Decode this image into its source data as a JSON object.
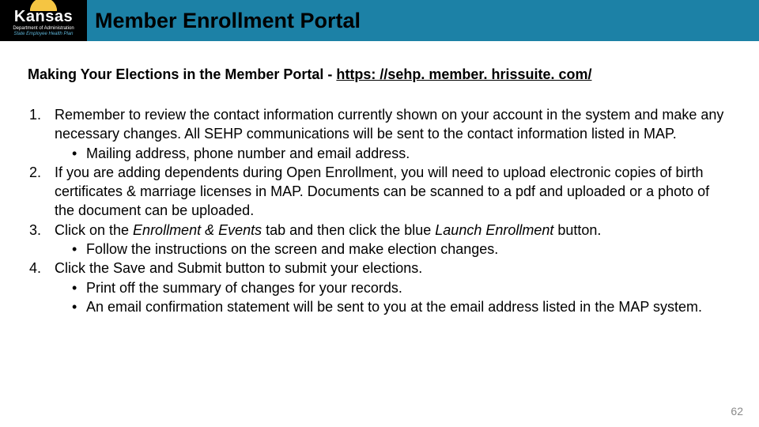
{
  "header": {
    "logo": {
      "main": "Kansas",
      "sub1": "Department of Administration",
      "sub2": "State Employee Health Plan"
    },
    "title": "Member Enrollment Portal"
  },
  "subheading": {
    "prefix": "Making Your Elections in the Member Portal - ",
    "link_text": "https: //sehp. member. hrissuite. com/",
    "link_href": "https://sehp.member.hrissuite.com/"
  },
  "steps": [
    {
      "num": "1.",
      "text": "Remember to review the contact information currently shown on your account in the system and make any necessary changes. All SEHP communications will be sent to the contact information listed in MAP.",
      "bullets": [
        "Mailing address, phone number and email address."
      ]
    },
    {
      "num": "2.",
      "text": "If you are adding dependents during Open Enrollment, you will need to upload electronic copies of birth certificates & marriage licenses in MAP.  Documents can be scanned to a pdf and uploaded or a photo of the document can be uploaded.",
      "bullets": []
    },
    {
      "num": "3.",
      "text_parts": [
        "Click on the ",
        "Enrollment & Events",
        " tab and then click the blue ",
        "Launch Enrollment",
        " button."
      ],
      "bullets": [
        "Follow the instructions on the screen and make election changes."
      ]
    },
    {
      "num": "4.",
      "text": "Click the Save and Submit button to submit your elections.",
      "bullets": [
        "Print off the summary of changes for your records.",
        "An email confirmation statement will be sent to you at the email address listed in the MAP system."
      ]
    }
  ],
  "page_number": "62"
}
